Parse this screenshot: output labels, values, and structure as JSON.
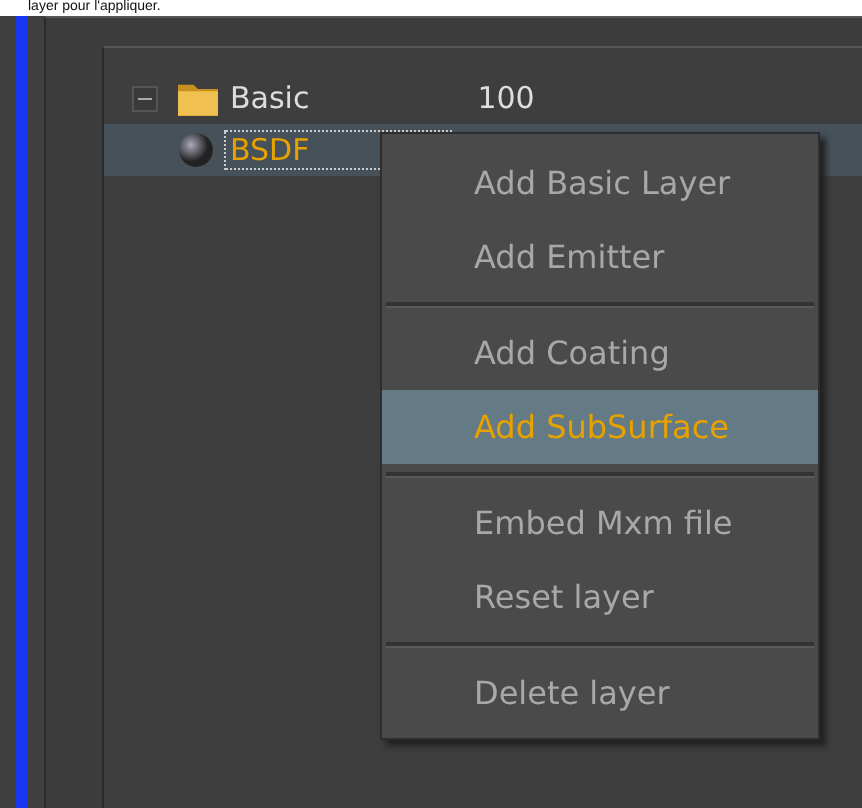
{
  "caption": "layer pour l'appliquer.",
  "tree": [
    {
      "label": "Basic",
      "value": "100",
      "expanded": true,
      "kind": "folder",
      "selected": false,
      "children": [
        {
          "label": "BSDF",
          "kind": "material",
          "selected": true
        }
      ]
    }
  ],
  "context_menu": [
    {
      "kind": "item",
      "label": "Add Basic Layer",
      "selected": false
    },
    {
      "kind": "item",
      "label": "Add Emitter",
      "selected": false
    },
    {
      "kind": "separator"
    },
    {
      "kind": "item",
      "label": "Add Coating",
      "selected": false
    },
    {
      "kind": "item",
      "label": "Add SubSurface",
      "selected": true
    },
    {
      "kind": "separator"
    },
    {
      "kind": "item",
      "label": "Embed Mxm file",
      "selected": false
    },
    {
      "kind": "item",
      "label": "Reset layer",
      "selected": false
    },
    {
      "kind": "separator"
    },
    {
      "kind": "item",
      "label": "Delete layer",
      "selected": false
    }
  ]
}
